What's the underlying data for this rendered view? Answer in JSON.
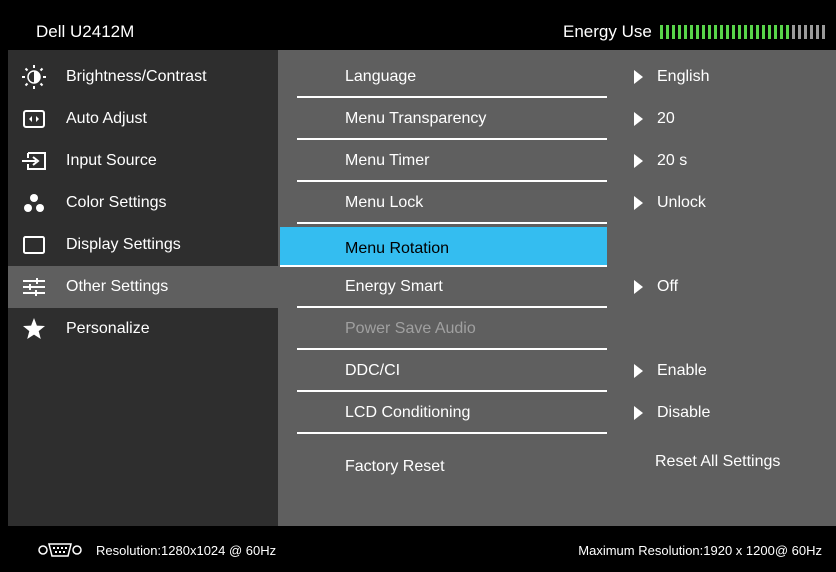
{
  "title": {
    "model": "Dell U2412M",
    "energy_label": "Energy Use",
    "energy_level": 0.8
  },
  "sidebar": {
    "items": [
      {
        "label": "Brightness/Contrast",
        "icon": "brightness-icon"
      },
      {
        "label": "Auto Adjust",
        "icon": "auto-adjust-icon"
      },
      {
        "label": "Input Source",
        "icon": "input-source-icon"
      },
      {
        "label": "Color Settings",
        "icon": "color-settings-icon"
      },
      {
        "label": "Display Settings",
        "icon": "display-settings-icon"
      },
      {
        "label": "Other Settings",
        "icon": "other-settings-icon"
      },
      {
        "label": "Personalize",
        "icon": "star-icon"
      }
    ],
    "active": "Other Settings"
  },
  "menu": {
    "rows": [
      {
        "label": "Language",
        "value": "English"
      },
      {
        "label": "Menu Transparency",
        "value": "20"
      },
      {
        "label": "Menu Timer",
        "value": "20 s"
      },
      {
        "label": "Menu Lock",
        "value": "Unlock"
      },
      {
        "label": "Menu Rotation",
        "value": ""
      },
      {
        "label": "Energy Smart",
        "value": "Off"
      },
      {
        "label": "Power Save Audio",
        "value": ""
      },
      {
        "label": "DDC/CI",
        "value": "Enable"
      },
      {
        "label": "LCD Conditioning",
        "value": "Disable"
      },
      {
        "label": "Factory Reset",
        "value": "Reset All Settings"
      }
    ],
    "selected": "Menu Rotation",
    "disabled": "Power Save Audio"
  },
  "status": {
    "resolution": "Resolution:1280x1024 @ 60Hz",
    "max_resolution": "Maximum Resolution:1920 x 1200@ 60Hz",
    "input_icon": "vga-icon"
  },
  "colors": {
    "highlight": "#34bdf0",
    "energy_on": "#58d54a",
    "energy_off": "#9a9a9a",
    "sidebar_bg": "#2e2e2e",
    "content_bg": "#5f5f5f"
  }
}
